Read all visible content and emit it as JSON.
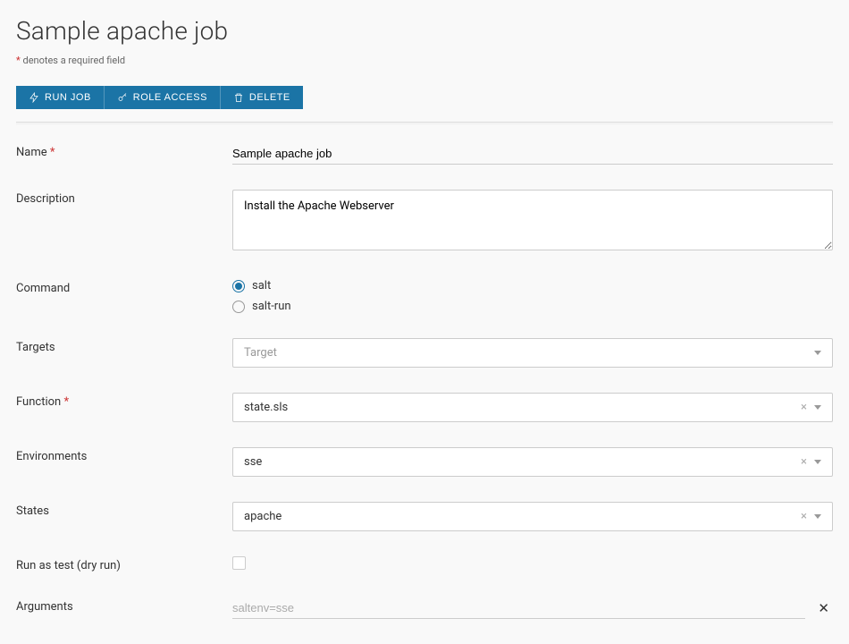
{
  "header": {
    "title": "Sample apache job",
    "required_note": "denotes a required field"
  },
  "toolbar": {
    "run_job": "RUN JOB",
    "role_access": "ROLE ACCESS",
    "delete": "DELETE"
  },
  "form": {
    "name": {
      "label": "Name",
      "value": "Sample apache job"
    },
    "description": {
      "label": "Description",
      "value": "Install the Apache Webserver"
    },
    "command": {
      "label": "Command",
      "options": {
        "salt": "salt",
        "salt_run": "salt-run"
      },
      "selected": "salt"
    },
    "targets": {
      "label": "Targets",
      "placeholder": "Target"
    },
    "function": {
      "label": "Function",
      "value": "state.sls"
    },
    "environments": {
      "label": "Environments",
      "value": "sse"
    },
    "states": {
      "label": "States",
      "value": "apache"
    },
    "run_as_test": {
      "label": "Run as test (dry run)",
      "checked": false
    },
    "arguments": {
      "label": "Arguments",
      "placeholder": "saltenv=sse"
    }
  }
}
